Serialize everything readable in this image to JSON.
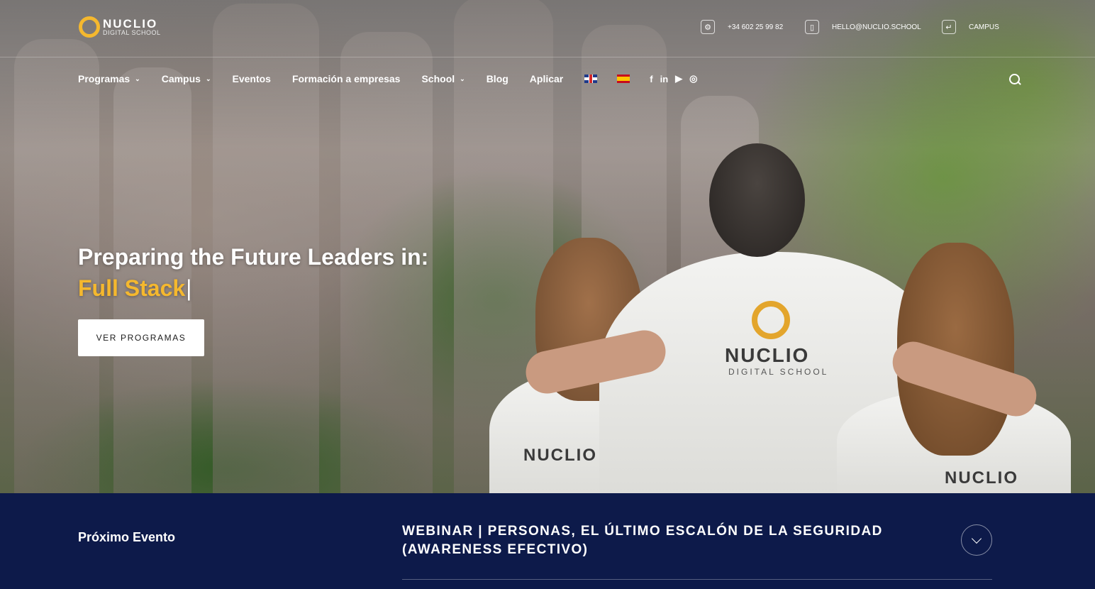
{
  "brand": {
    "name": "NUCLIO",
    "sub": "DIGITAL SCHOOL",
    "accent": "#f5b82e"
  },
  "contact": {
    "phone": "+34 602 25 99 82",
    "phone_icon": "gear-icon",
    "email": "HELLO@NUCLIO.SCHOOL",
    "email_icon": "phone-icon",
    "campus": "CAMPUS",
    "campus_icon": "login-icon"
  },
  "nav": {
    "items": [
      {
        "label": "Programas",
        "dropdown": true
      },
      {
        "label": "Campus",
        "dropdown": true
      },
      {
        "label": "Eventos",
        "dropdown": false
      },
      {
        "label": "Formación a empresas",
        "dropdown": false
      },
      {
        "label": "School",
        "dropdown": true
      },
      {
        "label": "Blog",
        "dropdown": false
      },
      {
        "label": "Aplicar",
        "dropdown": false
      }
    ],
    "languages": [
      "english-flag-icon",
      "spanish-flag-icon"
    ],
    "social": [
      "facebook-icon",
      "linkedin-icon",
      "youtube-icon",
      "instagram-icon"
    ],
    "search_icon": "search-icon"
  },
  "hero": {
    "headline": "Preparing the Future Leaders in:",
    "typed": "Full Stack",
    "cta": "VER PROGRAMAS",
    "shirt_logo": "NUCLIO",
    "shirt_sub": "DIGITAL SCHOOL"
  },
  "event": {
    "label": "Próximo Evento",
    "title": "WEBINAR | PERSONAS, EL ÚLTIMO ESCALÓN DE LA SEGURIDAD (AWARENESS EFECTIVO)",
    "band_color": "#0d1a4a"
  }
}
